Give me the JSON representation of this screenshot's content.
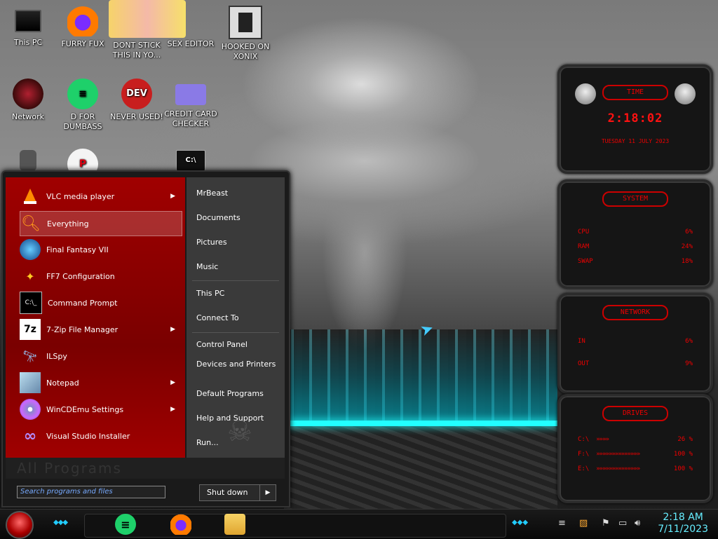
{
  "desktop": {
    "icons": [
      {
        "label": "This PC"
      },
      {
        "label": "FURRY FUX"
      },
      {
        "label": "DONT STICK THIS IN YO..."
      },
      {
        "label": "SEX EDITOR"
      },
      {
        "label": "HOOKED ON XONIX"
      },
      {
        "label": "Network"
      },
      {
        "label": "D FOR DUMBASS"
      },
      {
        "label": "NEVER USED!"
      },
      {
        "label": "CREDIT CARD CHECKER"
      }
    ],
    "dev_icon_text": "DEV"
  },
  "widgets": {
    "time": {
      "title": "TIME",
      "time": "2:18:02",
      "date": "TUESDAY 11 JULY 2023"
    },
    "system": {
      "title": "SYSTEM",
      "rows": [
        {
          "name": "CPU",
          "value": "6%"
        },
        {
          "name": "RAM",
          "value": "24%"
        },
        {
          "name": "SWAP",
          "value": "18%"
        }
      ]
    },
    "network": {
      "title": "NETWORK",
      "rows": [
        {
          "name": "IN",
          "value": "6%"
        },
        {
          "name": "OUT",
          "value": "9%"
        }
      ]
    },
    "drives": {
      "title": "DRIVES",
      "rows": [
        {
          "name": "C:\\",
          "value": "26 %"
        },
        {
          "name": "F:\\",
          "value": "100 %"
        },
        {
          "name": "E:\\",
          "value": "100 %"
        }
      ]
    }
  },
  "start_menu": {
    "programs": [
      {
        "label": "VLC media player",
        "has_submenu": true
      },
      {
        "label": "Everything",
        "selected": true
      },
      {
        "label": "Final Fantasy VII"
      },
      {
        "label": "FF7 Configuration"
      },
      {
        "label": "Command Prompt"
      },
      {
        "label": "7-Zip File Manager",
        "has_submenu": true
      },
      {
        "label": "ILSpy"
      },
      {
        "label": "Notepad",
        "has_submenu": true
      },
      {
        "label": "WinCDEmu Settings",
        "has_submenu": true
      },
      {
        "label": "Visual Studio Installer"
      }
    ],
    "all_programs": "All Programs",
    "right_items": [
      "MrBeast",
      "Documents",
      "Pictures",
      "Music",
      "This PC",
      "Connect To",
      "Control Panel",
      "Devices and Printers",
      "Default Programs",
      "Help and Support",
      "Run..."
    ],
    "search_placeholder": "Search programs and files",
    "shutdown_label": "Shut down"
  },
  "taskbar": {
    "time": "2:18 AM",
    "date": "7/11/2023"
  },
  "colors": {
    "accent_red": "#cc0000",
    "clock_cyan": "#66eeff"
  }
}
